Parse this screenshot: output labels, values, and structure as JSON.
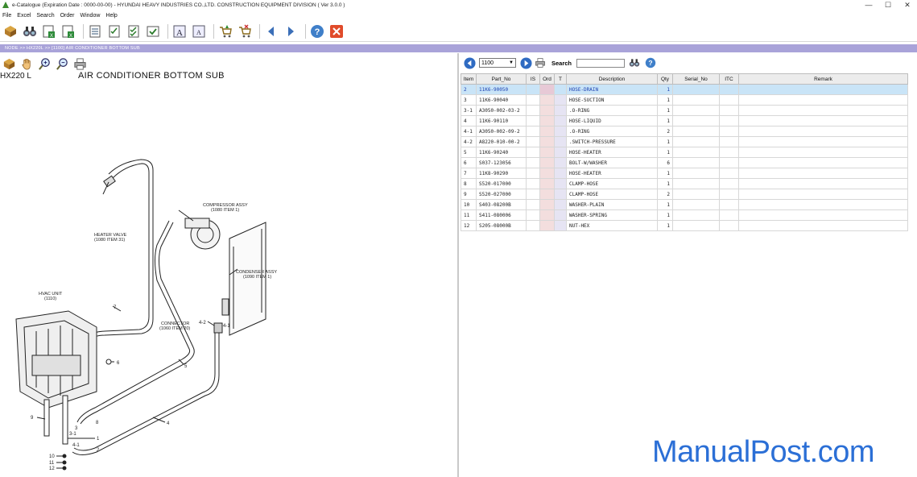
{
  "window": {
    "title": "e-Catalogue (Expiration Date : 0000-00-00)  -  HYUNDAI HEAVY INDUSTRIES CO.,LTD. CONSTRUCTION EQUIPMENT DIVISION ( Ver 3.0.0 )",
    "minimize": "—",
    "maximize": "☐",
    "close": "✕"
  },
  "menu": [
    "File",
    "Excel",
    "Search",
    "Order",
    "Window",
    "Help"
  ],
  "breadcrumb": "NODE >> HX220L >> [1100] AIR CONDITIONER BOTTOM SUB",
  "drawing": {
    "model": "HX220 L",
    "title": "AIR CONDITIONER BOTTOM SUB",
    "labels": {
      "heater_valve": "HEATER VALVE",
      "heater_valve_ref": "(1080 ITEM 31)",
      "compressor": "COMPRESSOR ASSY",
      "compressor_ref": "(1080 ITEM 1)",
      "condenser": "CONDENSER ASSY",
      "condenser_ref": "(1090 ITEM 1)",
      "hvac": "HVAC UNIT",
      "hvac_ref": "(1110)",
      "connector": "CONNECTOR",
      "connector_ref": "(1060 ITEM 20)"
    },
    "callouts": [
      "7",
      "4-2",
      "4-1",
      "5",
      "6",
      "4",
      "9",
      "8",
      "3",
      "3-1",
      "1",
      "4-1",
      "2",
      "10",
      "11",
      "12"
    ]
  },
  "right_toolbar": {
    "group_value": "1100",
    "search_label": "Search",
    "search_value": ""
  },
  "table": {
    "columns": [
      "Item",
      "Part_No",
      "IS",
      "Ord",
      "T",
      "Description",
      "Qty",
      "Serial_No",
      "ITC",
      "Remark"
    ],
    "rows": [
      {
        "item": "2",
        "part_no": "11K6-90050",
        "description": "HOSE-DRAIN",
        "qty": "1"
      },
      {
        "item": "3",
        "part_no": "11K6-90040",
        "description": "HOSE-SUCTION",
        "qty": "1"
      },
      {
        "item": "3-1",
        "part_no": "A3050-002-03-2",
        "description": ".O-RING",
        "qty": "1"
      },
      {
        "item": "4",
        "part_no": "11K6-90110",
        "description": "HOSE-LIQUID",
        "qty": "1"
      },
      {
        "item": "4-1",
        "part_no": "A3050-002-09-2",
        "description": ".O-RING",
        "qty": "2"
      },
      {
        "item": "4-2",
        "part_no": "A8220-010-00-2",
        "description": ".SWITCH-PRESSURE",
        "qty": "1"
      },
      {
        "item": "5",
        "part_no": "11K6-90240",
        "description": "HOSE-HEATER",
        "qty": "1"
      },
      {
        "item": "6",
        "part_no": "S037-123056",
        "description": "BOLT-W/WASHER",
        "qty": "6"
      },
      {
        "item": "7",
        "part_no": "11K8-90290",
        "description": "HOSE-HEATER",
        "qty": "1"
      },
      {
        "item": "8",
        "part_no": "S520-017000",
        "description": "CLAMP-HOSE",
        "qty": "1"
      },
      {
        "item": "9",
        "part_no": "S520-027000",
        "description": "CLAMP-HOSE",
        "qty": "2"
      },
      {
        "item": "10",
        "part_no": "S403-08200B",
        "description": "WASHER-PLAIN",
        "qty": "1"
      },
      {
        "item": "11",
        "part_no": "S411-080006",
        "description": "WASHER-SPRING",
        "qty": "1"
      },
      {
        "item": "12",
        "part_no": "S205-08000B",
        "description": "NUT-HEX",
        "qty": "1"
      }
    ]
  },
  "watermark": "ManualPost.com",
  "colors": {
    "breadcrumb_bg": "#a9a3d9",
    "selected_row": "#c9e4f7",
    "close_button": "#e04b2a",
    "watermark": "#2b6fd6"
  }
}
